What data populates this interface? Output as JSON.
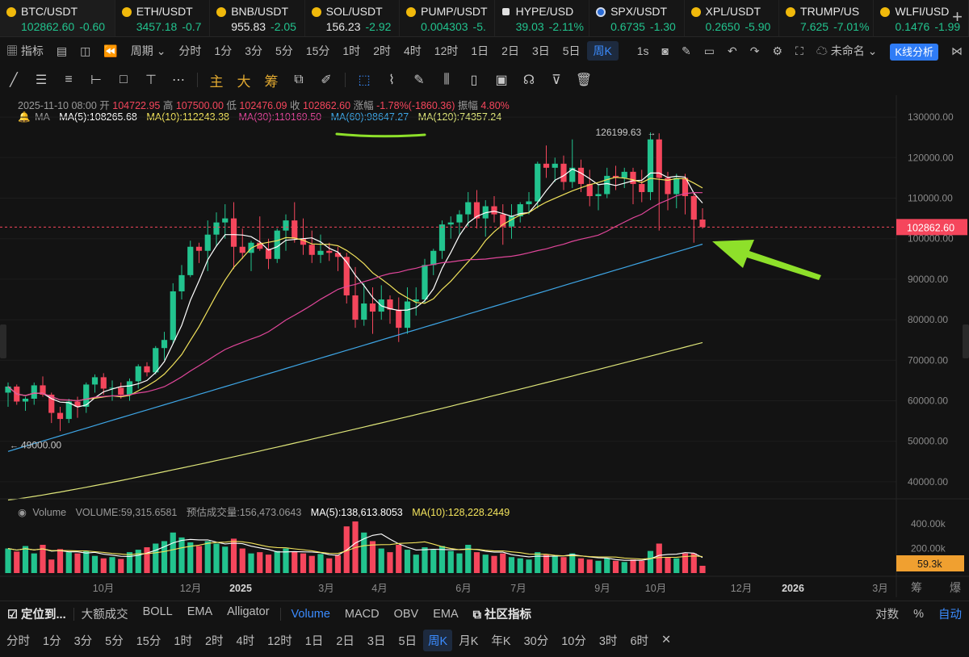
{
  "tickers": [
    {
      "name": "BTC/USDT",
      "price": "102862.60",
      "change": "-0.60",
      "active": true
    },
    {
      "name": "ETH/USDT",
      "price": "3457.18",
      "change": "-0.7"
    },
    {
      "name": "BNB/USDT",
      "price": "955.83",
      "change": "-2.05"
    },
    {
      "name": "SOL/USDT",
      "price": "156.23",
      "change": "-2.92"
    },
    {
      "name": "PUMP/USDT",
      "price": "0.004303",
      "change": "-5."
    },
    {
      "name": "HYPE/USD",
      "price": "39.03",
      "change": "-2.11%"
    },
    {
      "name": "SPX/USDT",
      "price": "0.6735",
      "change": "-1.30"
    },
    {
      "name": "XPL/USDT",
      "price": "0.2650",
      "change": "-5.90"
    },
    {
      "name": "TRUMP/US",
      "price": "7.625",
      "change": "-7.01%"
    },
    {
      "name": "WLFI/USD",
      "price": "0.1476",
      "change": "-1.99"
    }
  ],
  "toolbar": {
    "indicators": "指标",
    "period": "周期",
    "intervals": [
      "分时",
      "1分",
      "3分",
      "5分",
      "15分",
      "1时",
      "2时",
      "4时",
      "12时",
      "1日",
      "2日",
      "3日",
      "5日",
      "周K"
    ],
    "active_interval": "周K",
    "refresh": "1s",
    "layout_name": "未命名",
    "kline_analysis": "K线分析"
  },
  "drawing_tools": {
    "main": "主",
    "big": "大",
    "chip": "筹"
  },
  "ohlc": {
    "date": "2025-11-10 08:00",
    "open_label": "开",
    "open": "104722.95",
    "high_label": "高",
    "high": "107500.00",
    "low_label": "低",
    "low": "102476.09",
    "close_label": "收",
    "close": "102862.60",
    "change_label": "涨幅",
    "change": "-1.78%(-1860.36)",
    "amp_label": "振幅",
    "amp": "4.80%"
  },
  "ma_line": {
    "label": "MA",
    "ma5": "MA(5):108265.68",
    "ma10": "MA(10):112243.38",
    "ma30": "MA(30):110169.50",
    "ma60": "MA(60):98647.27",
    "ma120": "MA(120):74357.24"
  },
  "volume_line": {
    "label": "Volume",
    "volume": "VOLUME:59,315.6581",
    "estimate": "预估成交量:156,473.0643",
    "ma5": "MA(5):138,613.8053",
    "ma10": "MA(10):128,228.2449"
  },
  "price_axis": [
    "130000.00",
    "120000.00",
    "110000.00",
    "100000.00",
    "90000.00",
    "80000.00",
    "70000.00",
    "60000.00",
    "50000.00",
    "40000.00"
  ],
  "current_price_label": "102862.60",
  "volume_axis": [
    "400.00k",
    "200.00k"
  ],
  "current_volume_label": "59.3k",
  "time_axis": [
    "10月",
    "12月",
    "2025",
    "3月",
    "4月",
    "6月",
    "7月",
    "9月",
    "10月",
    "12月",
    "2026",
    "3月"
  ],
  "annotations": {
    "high": "126199.63",
    "low": "49000.00"
  },
  "colors": {
    "up": "#22c38e",
    "down": "#f5465c",
    "ma5": "#ffffff",
    "ma10": "#f2e35c",
    "ma30": "#e0469a",
    "ma60": "#3ea6e6",
    "ma120": "#dfe67a",
    "arrow": "#8ee02a",
    "accent": "#2f7cf6"
  },
  "bottom_bar": {
    "locate": "定位到...",
    "items": [
      "大额成交",
      "BOLL",
      "EMA",
      "Alligator"
    ],
    "sub_items": [
      "Volume",
      "MACD",
      "OBV",
      "EMA"
    ],
    "active_sub": "Volume",
    "community": "社区指标",
    "right": [
      "对数",
      "%",
      "自动"
    ]
  },
  "bottom_intervals": [
    "分时",
    "1分",
    "3分",
    "5分",
    "15分",
    "1时",
    "2时",
    "4时",
    "12时",
    "1日",
    "2日",
    "3日",
    "5日",
    "周K",
    "月K",
    "年K",
    "30分",
    "10分",
    "3时",
    "6时"
  ],
  "bottom_active_interval": "周K",
  "chart_data": {
    "type": "candlestick",
    "interval": "weekly",
    "ylim": [
      35000,
      135000
    ],
    "candles": [
      [
        62000,
        64500,
        58500,
        63500
      ],
      [
        63500,
        64000,
        59000,
        59800
      ],
      [
        59800,
        61000,
        57500,
        60500
      ],
      [
        60500,
        64500,
        59000,
        63800
      ],
      [
        63800,
        66000,
        61000,
        61500
      ],
      [
        61500,
        62000,
        54500,
        57000
      ],
      [
        57000,
        58500,
        52500,
        55500
      ],
      [
        55500,
        60500,
        54500,
        59800
      ],
      [
        59800,
        61000,
        55800,
        58500
      ],
      [
        58500,
        64500,
        57000,
        64000
      ],
      [
        64000,
        66500,
        62000,
        65800
      ],
      [
        65800,
        66800,
        61500,
        63000
      ],
      [
        63000,
        65000,
        60000,
        63200
      ],
      [
        63200,
        64500,
        60500,
        61500
      ],
      [
        61500,
        65500,
        60000,
        64800
      ],
      [
        64800,
        69000,
        63000,
        68500
      ],
      [
        68500,
        69500,
        66000,
        67000
      ],
      [
        67000,
        73500,
        66500,
        73000
      ],
      [
        73000,
        77000,
        70000,
        75000
      ],
      [
        75000,
        89000,
        74000,
        87000
      ],
      [
        87000,
        93500,
        85000,
        91000
      ],
      [
        91000,
        99500,
        90500,
        98000
      ],
      [
        98000,
        99000,
        94000,
        97000
      ],
      [
        97000,
        104500,
        92000,
        101000
      ],
      [
        101000,
        106500,
        98000,
        104000
      ],
      [
        104000,
        108500,
        100000,
        105000
      ],
      [
        105000,
        109000,
        92500,
        98000
      ],
      [
        98000,
        102500,
        95000,
        96500
      ],
      [
        96500,
        99500,
        92000,
        99000
      ],
      [
        99000,
        105500,
        97000,
        97500
      ],
      [
        97500,
        100000,
        92500,
        95000
      ],
      [
        95000,
        102500,
        94000,
        102000
      ],
      [
        102000,
        106000,
        97000,
        104500
      ],
      [
        104500,
        109000,
        99000,
        100000
      ],
      [
        100000,
        105000,
        96000,
        98500
      ],
      [
        98500,
        102000,
        94000,
        96000
      ],
      [
        96000,
        101000,
        94000,
        97000
      ],
      [
        97000,
        99000,
        94500,
        96500
      ],
      [
        96500,
        98000,
        92000,
        95500
      ],
      [
        95500,
        96500,
        84000,
        86000
      ],
      [
        86000,
        93000,
        78000,
        80000
      ],
      [
        80000,
        89000,
        78500,
        84000
      ],
      [
        84000,
        88000,
        76500,
        82000
      ],
      [
        82000,
        88500,
        80000,
        85000
      ],
      [
        85000,
        86000,
        79000,
        82500
      ],
      [
        82500,
        85500,
        74500,
        78000
      ],
      [
        78000,
        88000,
        76500,
        84500
      ],
      [
        84500,
        88000,
        81000,
        85000
      ],
      [
        85000,
        95000,
        84000,
        93500
      ],
      [
        93500,
        97500,
        91000,
        97000
      ],
      [
        97000,
        104500,
        95000,
        103500
      ],
      [
        103500,
        105500,
        100000,
        104000
      ],
      [
        104000,
        107000,
        101000,
        106000
      ],
      [
        106000,
        111500,
        103000,
        109000
      ],
      [
        109000,
        112000,
        102500,
        105000
      ],
      [
        105000,
        109500,
        100500,
        108000
      ],
      [
        108000,
        110500,
        104000,
        106000
      ],
      [
        106000,
        108500,
        98500,
        103000
      ],
      [
        103000,
        108500,
        100000,
        105500
      ],
      [
        105500,
        109000,
        104000,
        108500
      ],
      [
        108500,
        111500,
        106000,
        109200
      ],
      [
        109200,
        119000,
        107500,
        118500
      ],
      [
        118500,
        123000,
        115000,
        117500
      ],
      [
        117500,
        120000,
        114000,
        118500
      ],
      [
        118500,
        120500,
        112000,
        114000
      ],
      [
        114000,
        124500,
        112500,
        117500
      ],
      [
        117500,
        119500,
        111500,
        113500
      ],
      [
        113500,
        117000,
        108000,
        110500
      ],
      [
        110500,
        113500,
        107000,
        111000
      ],
      [
        111000,
        117500,
        110000,
        115500
      ],
      [
        115500,
        118000,
        112000,
        115000
      ],
      [
        115000,
        117500,
        112500,
        116500
      ],
      [
        116500,
        117500,
        108500,
        113500
      ],
      [
        113500,
        117000,
        109000,
        111500
      ],
      [
        111500,
        126199.63,
        109500,
        124500
      ],
      [
        124500,
        126000,
        102000,
        115000
      ],
      [
        115000,
        116500,
        107000,
        111000
      ],
      [
        111000,
        116000,
        107500,
        115000
      ],
      [
        115000,
        116000,
        106000,
        110500
      ],
      [
        110500,
        111500,
        99000,
        104700
      ],
      [
        104722.95,
        107500,
        102476.09,
        102862.6
      ]
    ],
    "volume_k": [
      200,
      175,
      220,
      160,
      230,
      110,
      195,
      170,
      160,
      180,
      140,
      120,
      130,
      115,
      170,
      190,
      210,
      240,
      260,
      330,
      290,
      250,
      220,
      260,
      240,
      215,
      280,
      200,
      160,
      170,
      150,
      180,
      200,
      175,
      160,
      140,
      155,
      120,
      145,
      380,
      420,
      330,
      260,
      200,
      170,
      230,
      190,
      150,
      210,
      190,
      220,
      180,
      160,
      230,
      170,
      150,
      140,
      160,
      130,
      120,
      110,
      170,
      150,
      140,
      130,
      160,
      120,
      110,
      100,
      120,
      100,
      90,
      110,
      100,
      180,
      240,
      130,
      120,
      160,
      160,
      59.3
    ]
  }
}
